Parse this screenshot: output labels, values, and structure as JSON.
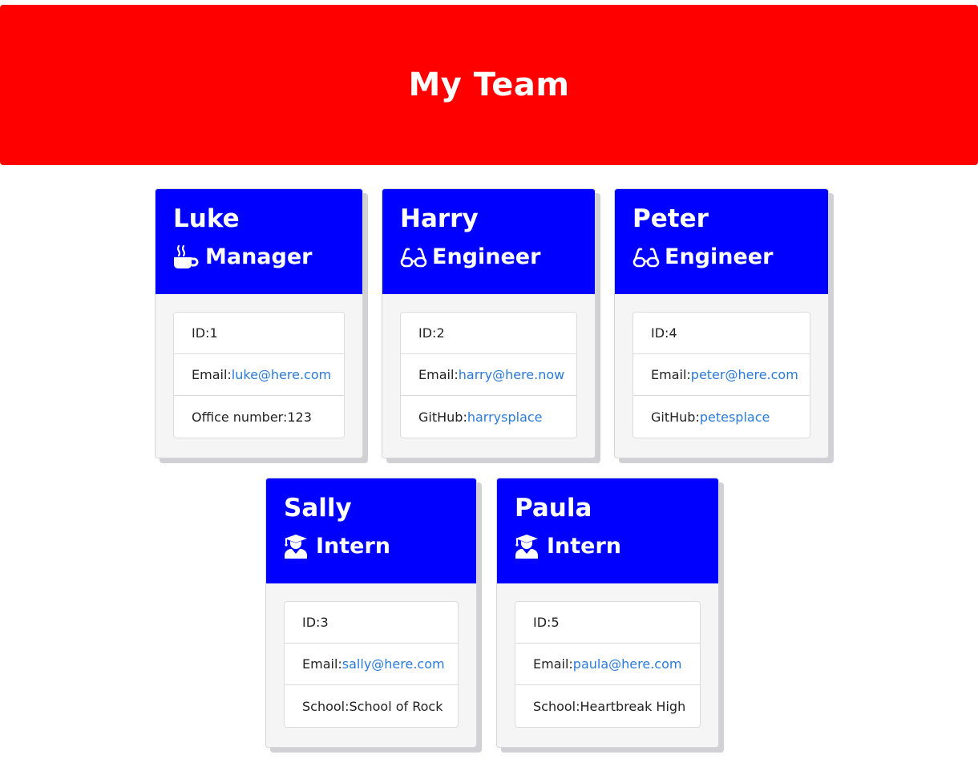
{
  "header": {
    "title": "My Team"
  },
  "colors": {
    "header_bg": "#ff0000",
    "card_header_bg": "#0000ff",
    "link": "#2a7ad8"
  },
  "team": [
    {
      "name": "Luke",
      "role": "Manager",
      "icon": "coffee-icon",
      "id_label": "ID: ",
      "id": "1",
      "email_label": "Email: ",
      "email": "luke@here.com",
      "extra_label": "Office number: ",
      "extra": "123"
    },
    {
      "name": "Harry",
      "role": "Engineer",
      "icon": "glasses-icon",
      "id_label": "ID: ",
      "id": "2",
      "email_label": "Email: ",
      "email": "harry@here.now",
      "extra_label": "GitHub: ",
      "extra": "harrysplace"
    },
    {
      "name": "Peter",
      "role": "Engineer",
      "icon": "glasses-icon",
      "id_label": "ID: ",
      "id": "4",
      "email_label": "Email: ",
      "email": "peter@here.com",
      "extra_label": "GitHub: ",
      "extra": "petesplace"
    },
    {
      "name": "Sally",
      "role": "Intern",
      "icon": "graduate-icon",
      "id_label": "ID: ",
      "id": "3",
      "email_label": "Email: ",
      "email": "sally@here.com",
      "extra_label": "School: ",
      "extra": "School of Rock"
    },
    {
      "name": "Paula",
      "role": "Intern",
      "icon": "graduate-icon",
      "id_label": "ID: ",
      "id": "5",
      "email_label": "Email: ",
      "email": "paula@here.com",
      "extra_label": "School: ",
      "extra": "Heartbreak High"
    }
  ]
}
